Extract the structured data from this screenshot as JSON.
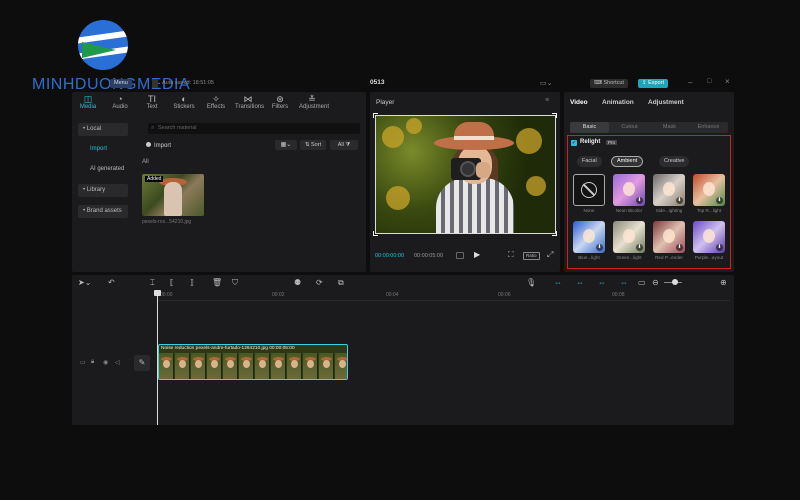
{
  "watermark": {
    "text": "MINHDUONGMEDIA"
  },
  "topbar": {
    "menu_label": "Menu",
    "autosave_text": "Auto saved: 18:51:05",
    "project_title": "0513",
    "shortcut_label": "Shortcut",
    "export_label": "Export"
  },
  "media_toolbar": {
    "tools": [
      {
        "label": "Media",
        "icon": "◫",
        "name": "media"
      },
      {
        "label": "Audio",
        "icon": "◔",
        "name": "audio"
      },
      {
        "label": "Text",
        "icon": "TI",
        "name": "text"
      },
      {
        "label": "Stickers",
        "icon": "◐",
        "name": "stickers"
      },
      {
        "label": "Effects",
        "icon": "✧",
        "name": "effects"
      },
      {
        "label": "Transitions",
        "icon": "⋈",
        "name": "transitions"
      },
      {
        "label": "Filters",
        "icon": "⊛",
        "name": "filters"
      },
      {
        "label": "Adjustment",
        "icon": "≚",
        "name": "adjustment"
      }
    ]
  },
  "media_sidebar": {
    "items": [
      "• Local",
      "Import",
      "AI generated",
      "• Library",
      "• Brand assets"
    ]
  },
  "media_main": {
    "search_placeholder": "Search material",
    "import_label": "Import",
    "sort_label": "Sort",
    "all_label": "All",
    "filter_all": "All",
    "thumb_badge": "Added",
    "thumb_name": "pexels-ros...54210.jpg"
  },
  "player": {
    "title": "Player",
    "time_current": "00:00:00:00",
    "time_total": "00:00:05:00",
    "ratio_label": "Ratio"
  },
  "right_panel": {
    "tabs": [
      "Video",
      "Animation",
      "Adjustment"
    ],
    "subtabs": [
      "Basic",
      "Cutout",
      "Mask",
      "Enhance"
    ],
    "relight_label": "Relight",
    "relight_badge": "Pro",
    "chips": [
      "Facial",
      "Ambient",
      "Creative"
    ],
    "presets": [
      {
        "label": "None"
      },
      {
        "label": "Neon Bicolor"
      },
      {
        "label": "Side...ighting"
      },
      {
        "label": "Top R...light"
      },
      {
        "label": "Blue...light"
      },
      {
        "label": "Green...light"
      },
      {
        "label": "Red P...ender"
      },
      {
        "label": "Purple...ayout"
      }
    ]
  },
  "timeline": {
    "ruler_ticks": [
      "00:00",
      "00:02",
      "00:04",
      "00:06",
      "00:08"
    ],
    "clip_label": "Noise reduction  pexels-andre-furtado-1264210.jpg  00:00:05:00"
  },
  "colors": {
    "accent": "#27c0d6",
    "highlight_box": "#d02020",
    "panel_bg": "#1b1b1d",
    "background": "#0d0d0d"
  }
}
